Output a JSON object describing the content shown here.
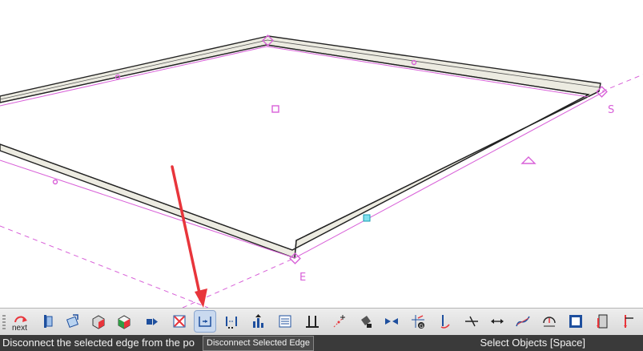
{
  "viewport": {
    "point_labels": {
      "s": "S",
      "e": "E"
    }
  },
  "toolbar": {
    "next_label": "next",
    "buttons": [
      "next-icon",
      "edge-book-icon",
      "redraw-icon",
      "cube-section-icon",
      "cube-color-icon",
      "transfer-icon",
      "delete-edge-icon",
      "disconnect-edge-icon",
      "break-line-icon",
      "align-icon",
      "layer-list-icon",
      "gable-icon",
      "add-point-icon",
      "paint-bucket-icon",
      "join-icon",
      "snap-grid-icon",
      "vertical-icon",
      "bend-icon",
      "dimension-icon",
      "curve-icon",
      "arc-icon",
      "frame-icon",
      "open-door-icon",
      "elevation-icon"
    ],
    "accent": "#e8353b"
  },
  "status": {
    "message": "Disconnect the selected edge from the po",
    "mode": "Select Objects [Space]"
  },
  "tooltip": {
    "text": "Disconnect Selected Edge"
  },
  "colors": {
    "selection": "#d860d8",
    "wall_fill": "#ecebe1",
    "status_bg": "#3a3a3a",
    "arrow": "#e8353b"
  }
}
